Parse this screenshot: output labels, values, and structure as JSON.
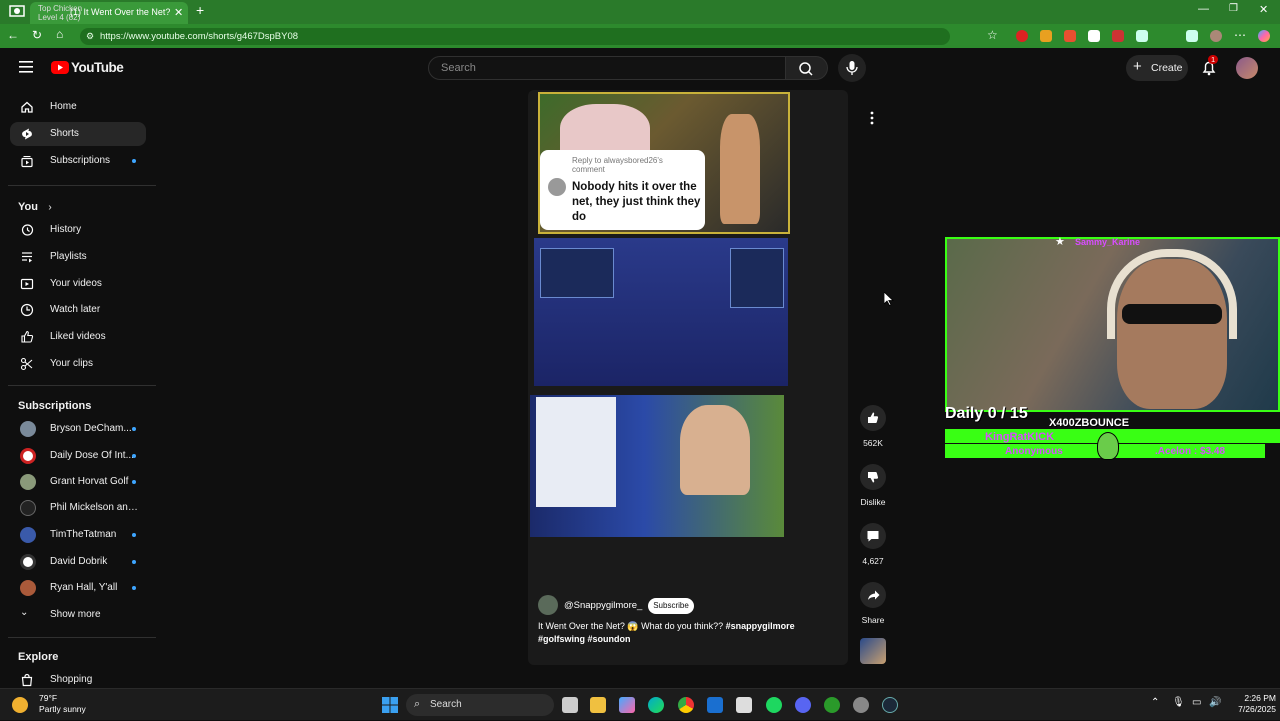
{
  "browser": {
    "tab_title": "(1) It Went Over the Net? 😱",
    "tab_overlay_line1": "Top Chicken",
    "tab_overlay_line2": "Level 4 (82)",
    "url": "https://www.youtube.com/shorts/g467DspBY08"
  },
  "header": {
    "logo_text": "YouTube",
    "search_placeholder": "Search",
    "create_label": "Create",
    "notification_count": "1"
  },
  "sidebar": {
    "main": [
      {
        "label": "Home",
        "icon": "home-icon"
      },
      {
        "label": "Shorts",
        "icon": "shorts-icon"
      },
      {
        "label": "Subscriptions",
        "icon": "subscriptions-icon"
      }
    ],
    "you_title": "You",
    "you": [
      {
        "label": "History",
        "icon": "history-icon"
      },
      {
        "label": "Playlists",
        "icon": "playlists-icon"
      },
      {
        "label": "Your videos",
        "icon": "your-videos-icon"
      },
      {
        "label": "Watch later",
        "icon": "watch-later-icon"
      },
      {
        "label": "Liked videos",
        "icon": "liked-videos-icon"
      },
      {
        "label": "Your clips",
        "icon": "clips-icon"
      }
    ],
    "subs_title": "Subscriptions",
    "subs": [
      {
        "label": "Bryson DeCham...",
        "color": "#7a8a9a"
      },
      {
        "label": "Daily Dose Of Int...",
        "color": "#cc2222"
      },
      {
        "label": "Grant Horvat Golf",
        "color": "#8a9a7a"
      },
      {
        "label": "Phil Mickelson and ...",
        "color": "#222222"
      },
      {
        "label": "TimTheTatman",
        "color": "#3a5aaa"
      },
      {
        "label": "David Dobrik",
        "color": "#ffffff"
      },
      {
        "label": "Ryan Hall, Y'all",
        "color": "#aa5a3a"
      }
    ],
    "show_more": "Show more",
    "explore_title": "Explore",
    "explore": [
      {
        "label": "Shopping",
        "icon": "shopping-icon"
      }
    ]
  },
  "short": {
    "reply_to": "Reply to alwaysbored26's comment",
    "comment_text": "Nobody hits it over the net, they just think they do",
    "creator": "@Snappygilmore_",
    "subscribe_label": "Subscribe",
    "caption_plain": "It Went Over the Net? 😱 What do you think?? ",
    "caption_tags": "#snappygilmore #golfswing #soundon"
  },
  "actions": {
    "likes": "562K",
    "dislike_label": "Dislike",
    "comments": "4,627",
    "share_label": "Share"
  },
  "stream_overlay": {
    "cam_name": "Sammy_Karine",
    "daily_counter": "Daily 0 / 15",
    "gamertag": "X400ZBOUNCE",
    "kick_user": "KingRatKICK",
    "anon_label": "Anonymous",
    "donation": ".Acelon : $3.48"
  },
  "taskbar": {
    "temperature": "79°F",
    "weather": "Partly sunny",
    "search_label": "Search",
    "time": "2:26 PM",
    "date": "7/26/2025"
  },
  "colors": {
    "browser_chrome": "#2d8a2d",
    "yt_red": "#ff0000",
    "subscription_dot": "#3ea6ff",
    "overlay_green": "#39ff14",
    "overlay_purple": "#d84dff"
  }
}
